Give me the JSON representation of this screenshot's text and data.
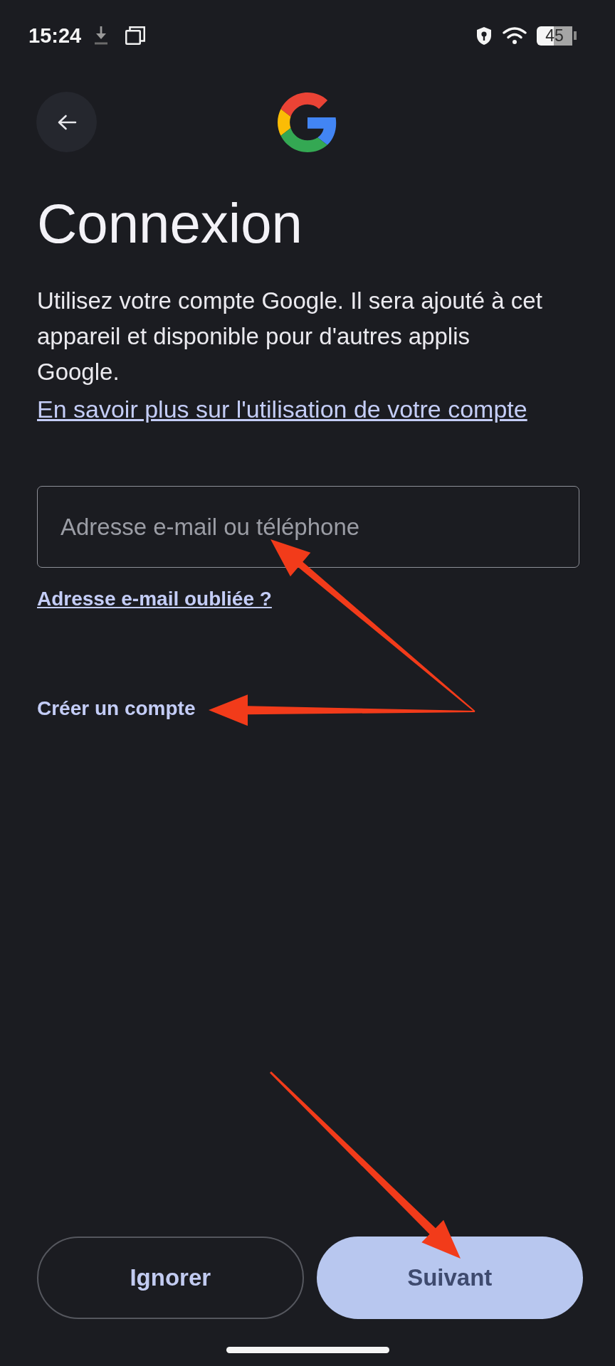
{
  "status_bar": {
    "time": "15:24",
    "battery": "45"
  },
  "title": "Connexion",
  "description": "Utilisez votre compte Google. Il sera ajouté à cet appareil et disponible pour d'autres applis Google.",
  "learn_more_link": "En savoir plus sur l'utilisation de votre compte",
  "email_field": {
    "placeholder": "Adresse e-mail ou téléphone"
  },
  "forgot_email_link": "Adresse e-mail oubliée ?",
  "create_account_link": "Créer un compte",
  "buttons": [
    {
      "label": "Ignorer",
      "kind": "outlined"
    },
    {
      "label": "Suivant",
      "kind": "filled"
    }
  ]
}
